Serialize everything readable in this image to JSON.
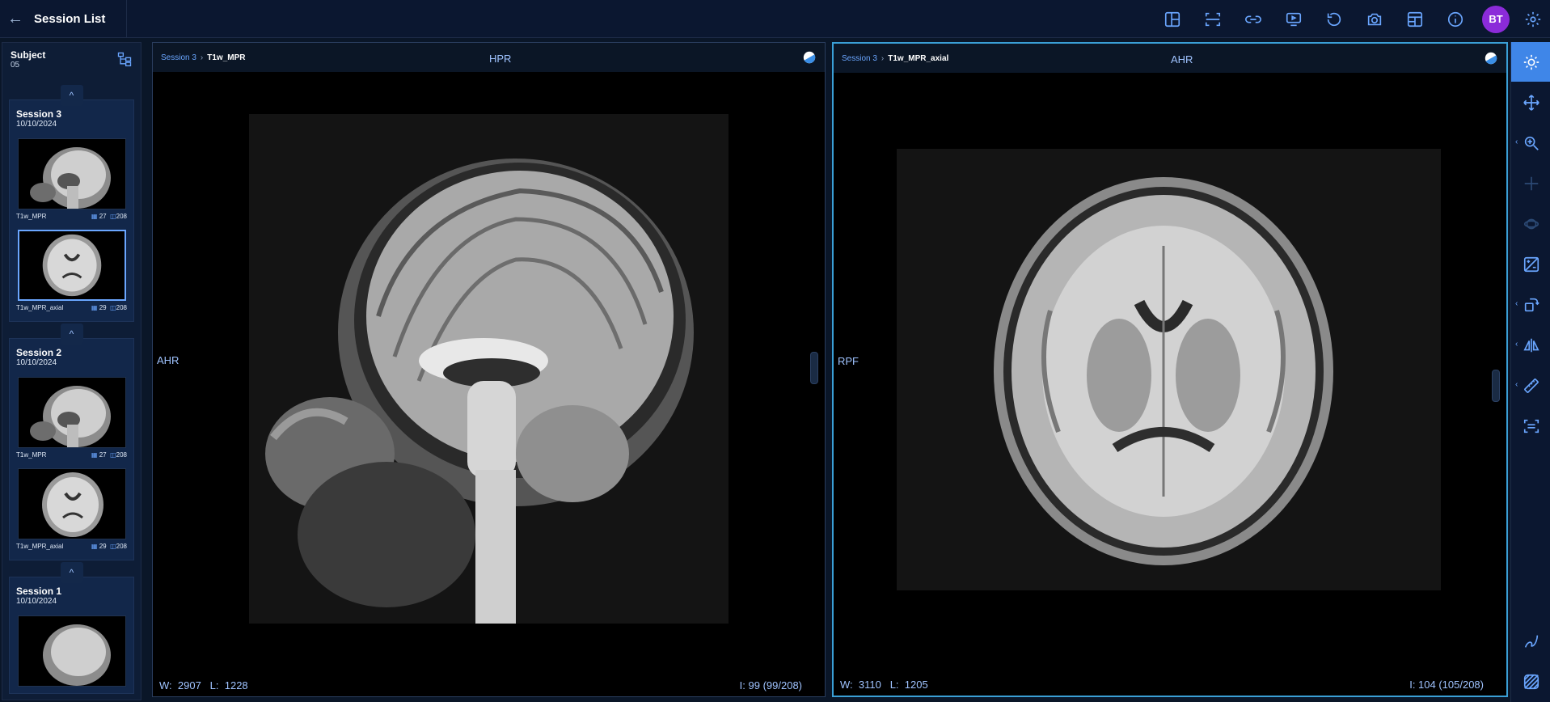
{
  "header": {
    "back_icon": "arrow-left-icon",
    "title": "Session List",
    "tools": [
      "layout-icon",
      "crosshair-frame-icon",
      "link-icon",
      "presentation-icon",
      "reset-icon",
      "camera-icon",
      "panels-icon",
      "info-icon"
    ],
    "avatar_initials": "BT",
    "settings_icon": "gear-icon"
  },
  "sidebar": {
    "subject_label": "Subject",
    "subject_id": "05",
    "sessions": [
      {
        "title": "Session 3",
        "date": "10/10/2024",
        "series": [
          {
            "name": "T1w_MPR",
            "a": "27",
            "b": "208"
          },
          {
            "name": "T1w_MPR_axial",
            "a": "29",
            "b": "208"
          }
        ]
      },
      {
        "title": "Session 2",
        "date": "10/10/2024",
        "series": [
          {
            "name": "T1w_MPR",
            "a": "27",
            "b": "208"
          },
          {
            "name": "T1w_MPR_axial",
            "a": "29",
            "b": "208"
          }
        ]
      },
      {
        "title": "Session 1",
        "date": "10/10/2024"
      }
    ]
  },
  "viewports": [
    {
      "session": "Session 3",
      "series": "T1w_MPR",
      "orient_top": "HPR",
      "orient_left": "AHR",
      "w_label": "W:",
      "w": "2907",
      "l_label": "L:",
      "l": "1228",
      "slice": "I: 99 (99/208)"
    },
    {
      "session": "Session 3",
      "series": "T1w_MPR_axial",
      "orient_top": "AHR",
      "orient_left": "RPF",
      "w_label": "W:",
      "w": "3110",
      "l_label": "L:",
      "l": "1205",
      "slice": "I: 104 (105/208)"
    }
  ],
  "crumb_sep": "›",
  "right_tools": [
    "window-level-icon",
    "pan-icon",
    "zoom-icon",
    "crosshair-icon",
    "rotate-3d-icon",
    "invert-icon",
    "rotate-icon",
    "flip-icon",
    "ruler-icon",
    "fit-icon",
    "freehand-icon",
    "texture-icon"
  ]
}
